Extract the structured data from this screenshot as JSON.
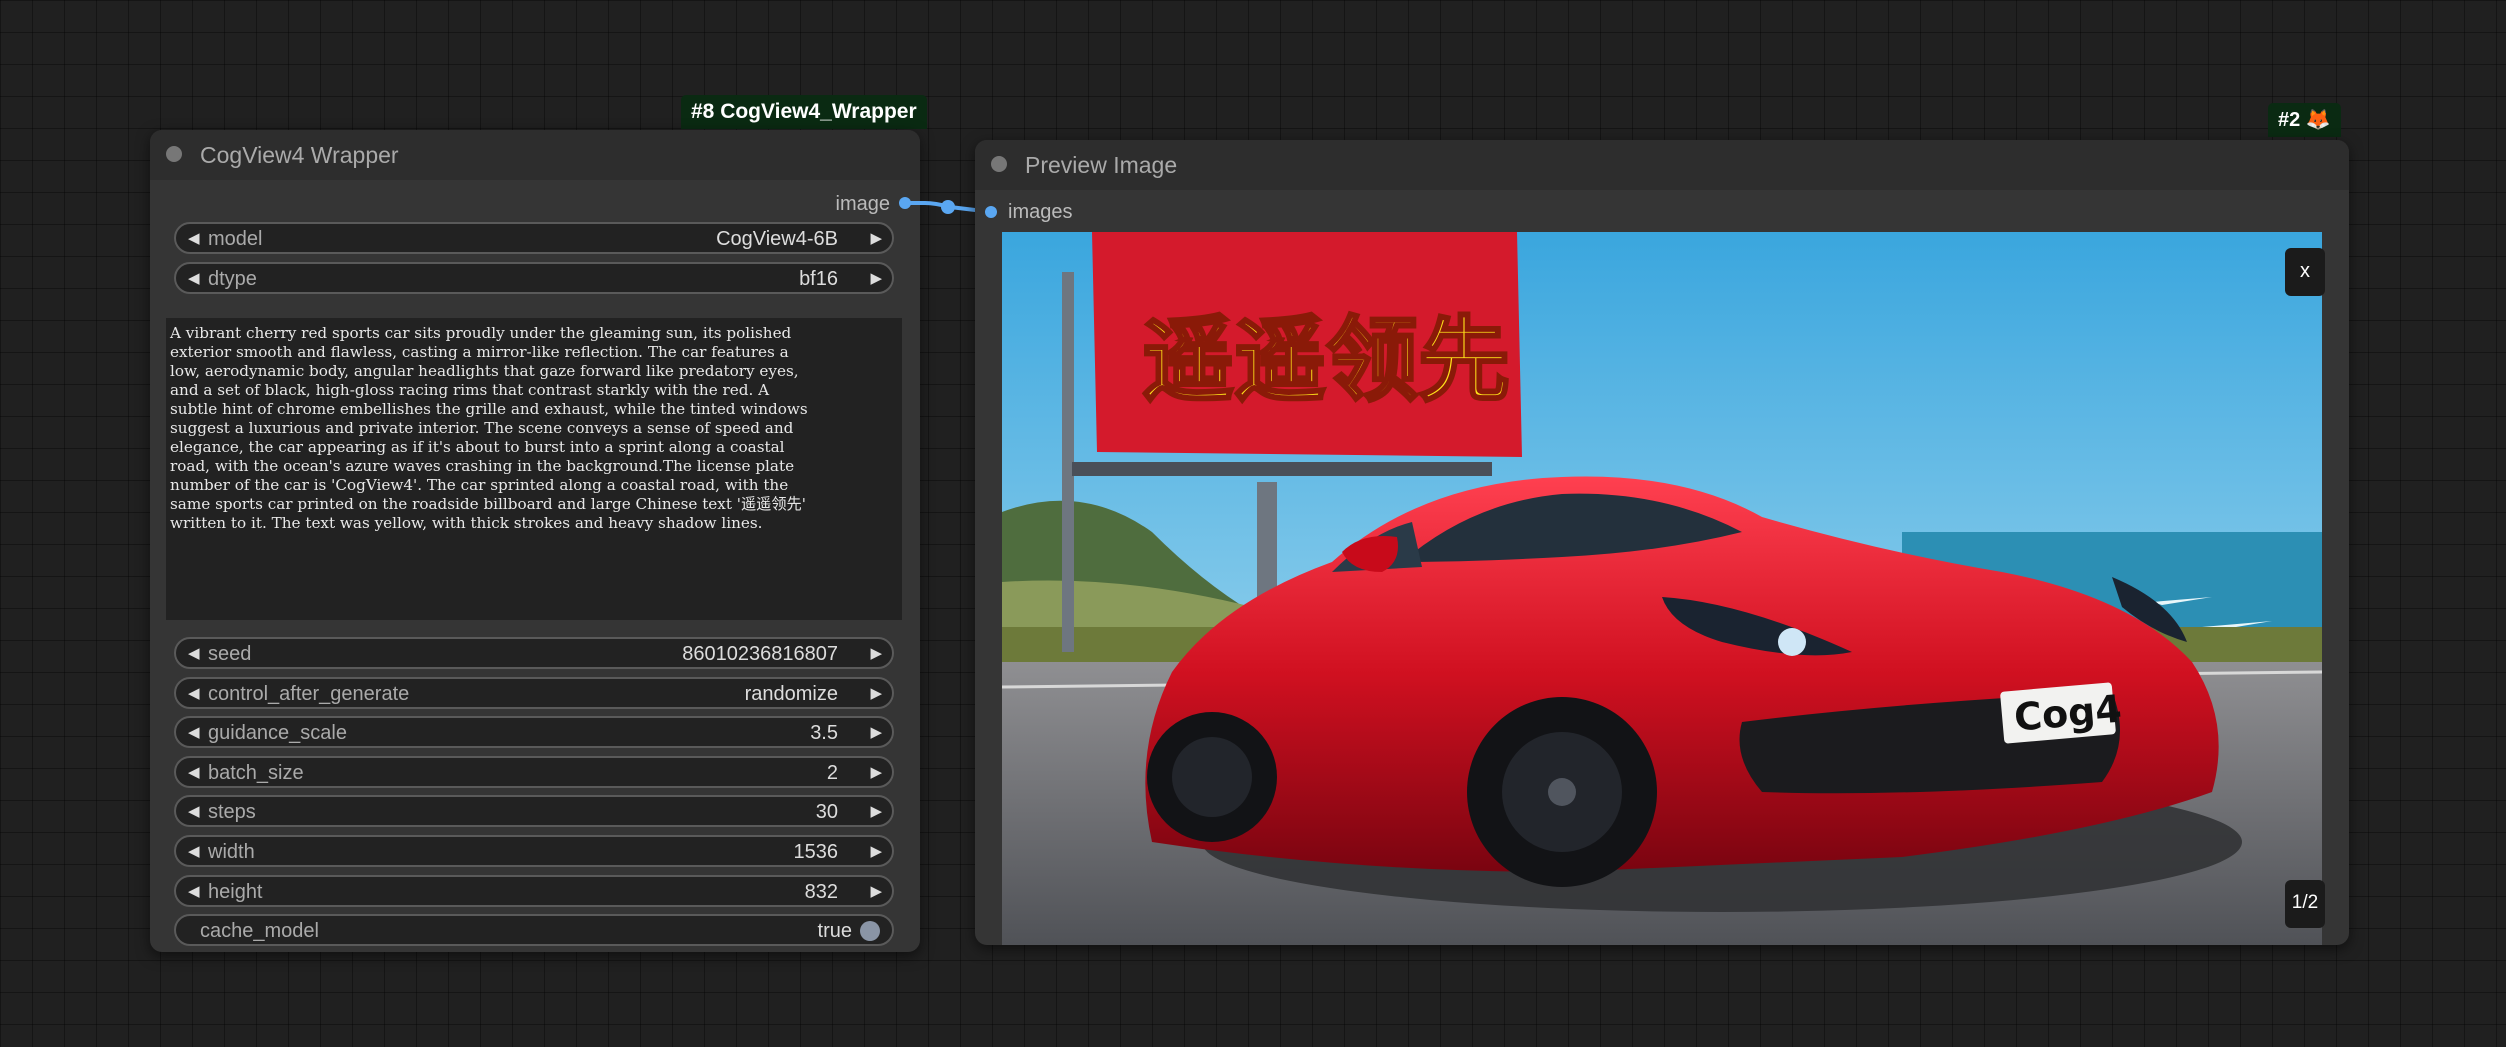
{
  "wrapper_node": {
    "badge": "#8 CogView4_Wrapper",
    "title": "CogView4 Wrapper",
    "output_label": "image",
    "widgets": [
      {
        "label": "model",
        "value": "CogView4-6B"
      },
      {
        "label": "dtype",
        "value": "bf16"
      }
    ],
    "prompt": "A vibrant cherry red sports car sits proudly under the gleaming sun, its polished\nexterior smooth and flawless, casting a mirror-like reflection. The car features a\nlow, aerodynamic body, angular headlights that gaze forward like predatory eyes,\nand a set of black, high-gloss racing rims that contrast starkly with the red. A\nsubtle hint of chrome embellishes the grille and exhaust, while the tinted windows\nsuggest a luxurious and private interior. The scene conveys a sense of speed and\nelegance, the car appearing as if it's about to burst into a sprint along a coastal\nroad, with the ocean's azure waves crashing in the background.The license plate\nnumber of the car is 'CogView4'. The car sprinted along a coastal road, with the\nsame sports car printed on the roadside billboard and large Chinese text '遥遥领先'\nwritten to it. The text was yellow, with thick strokes and heavy shadow lines.",
    "params": [
      {
        "label": "seed",
        "value": "86010236816807"
      },
      {
        "label": "control_after_generate",
        "value": "randomize"
      },
      {
        "label": "guidance_scale",
        "value": "3.5"
      },
      {
        "label": "batch_size",
        "value": "2"
      },
      {
        "label": "steps",
        "value": "30"
      },
      {
        "label": "width",
        "value": "1536"
      },
      {
        "label": "height",
        "value": "832"
      }
    ],
    "toggle": {
      "label": "cache_model",
      "value": "true"
    }
  },
  "preview_node": {
    "badge": "#2 🦊",
    "title": "Preview Image",
    "input_label": "images",
    "close_label": "x",
    "page_indicator": "1/2",
    "image": {
      "billboard_text": "遥遥领先",
      "plate_text": "Cog4"
    }
  },
  "colors": {
    "canvas": "#202020",
    "node_body": "#353535",
    "node_header": "#2d2d2d",
    "badge_bg": "#0a2a12",
    "link": "#5aa7f2",
    "car_red": "#d01020",
    "billboard_red": "#d41a2c",
    "billboard_text": "#ffe21a"
  }
}
